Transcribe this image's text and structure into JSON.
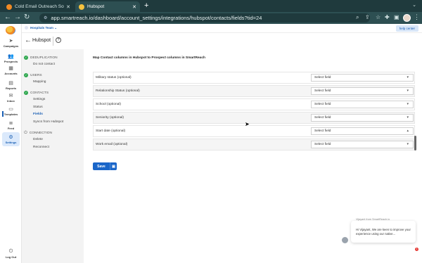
{
  "browser": {
    "tabs": [
      {
        "title": "Cold Email Outreach Software",
        "active": false
      },
      {
        "title": "Hubspot",
        "active": true
      }
    ],
    "url": "app.smartreach.io/dashboard/account_settings/integrations/hubspot/contacts/fields?tid=24"
  },
  "leftnav": {
    "items": [
      {
        "label": "Campaigns",
        "icon": "send-icon"
      },
      {
        "label": "Prospects",
        "icon": "users-icon"
      },
      {
        "label": "Accounts",
        "icon": "building-icon"
      },
      {
        "label": "Reports",
        "icon": "chart-icon"
      },
      {
        "label": "Inbox",
        "icon": "mail-icon"
      },
      {
        "label": "Templates",
        "icon": "template-icon"
      },
      {
        "label": "Feed",
        "icon": "feed-icon"
      },
      {
        "label": "Settings",
        "icon": "gear-icon",
        "active": true
      }
    ],
    "logout": "Log Out"
  },
  "topstrip": {
    "team": "Hospitals Team",
    "help": "help center"
  },
  "header": {
    "title": "Hubspot"
  },
  "sidenav": {
    "dedup": {
      "title": "DEDUPLICATION",
      "items": [
        "Do not contact"
      ]
    },
    "users": {
      "title": "USERS",
      "items": [
        "Mapping"
      ]
    },
    "contacts": {
      "title": "CONTACTS",
      "items": [
        "Settings",
        "Status",
        "Fields",
        "Syncs from Hubspot"
      ]
    },
    "connection": {
      "title": "CONNECTION",
      "items": [
        "Delete",
        "Reconnect"
      ]
    }
  },
  "main": {
    "title": "Map Contact columns in Hubspot to Prospect columns in SmartReach",
    "rows": [
      {
        "label": "Military status (optional)",
        "value": "Select field"
      },
      {
        "label": "Relationship Status (optional)",
        "value": "Select field"
      },
      {
        "label": "School (optional)",
        "value": "Select field"
      },
      {
        "label": "Seniority (optional)",
        "value": "Select field"
      },
      {
        "label": "Start date (optional)",
        "value": "Select field"
      },
      {
        "label": "Work email (optional)",
        "value": "Select field"
      }
    ],
    "save": "Save"
  },
  "chat": {
    "from": "Vijayant from SmartReach.io",
    "message": "Hi Vijayant, We are keen to improve your experience using our native...",
    "badge": "1"
  }
}
